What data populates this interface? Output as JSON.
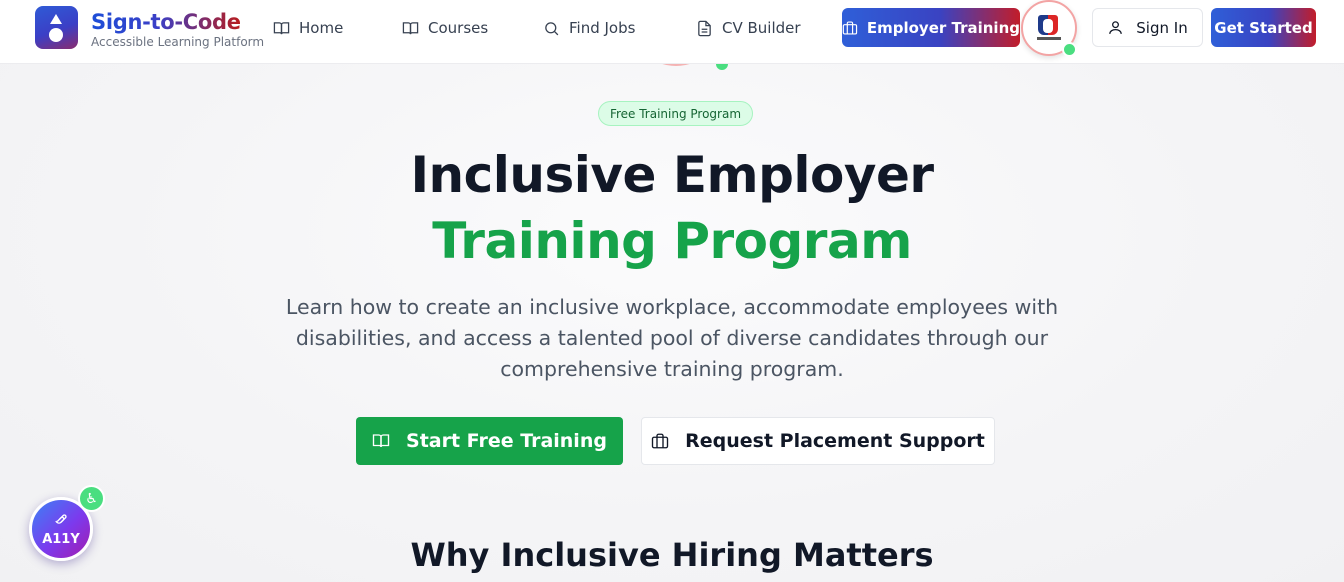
{
  "brand": {
    "name": "Sign-to-Code",
    "tagline": "Accessible Learning Platform",
    "logo_icon": "logo-icon"
  },
  "nav": {
    "items": [
      {
        "label": "Home",
        "icon": "book-open-icon"
      },
      {
        "label": "Courses",
        "icon": "book-open-icon"
      },
      {
        "label": "Find Jobs",
        "icon": "search-icon"
      },
      {
        "label": "CV Builder",
        "icon": "document-icon"
      }
    ],
    "employer_training": {
      "label": "Employer Training",
      "icon": "briefcase-icon"
    },
    "avatar": {
      "icon": "sign-language-avatar",
      "status": "online"
    },
    "sign_in": {
      "label": "Sign In",
      "icon": "user-icon"
    },
    "get_started": {
      "label": "Get Started"
    }
  },
  "hero": {
    "badge": "Free Training Program",
    "title_line1": "Inclusive Employer",
    "title_line2": "Training Program",
    "description": "Learn how to create an inclusive workplace, accommodate employees with disabilities, and access a talented pool of diverse candidates through our comprehensive training program.",
    "primary_button": {
      "label": "Start Free Training",
      "icon": "book-open-icon"
    },
    "secondary_button": {
      "label": "Request Placement Support",
      "icon": "briefcase-icon"
    }
  },
  "section": {
    "title": "Why Inclusive Hiring Matters"
  },
  "accessibility_widget": {
    "label": "A11Y",
    "icon": "hand-icon",
    "badge_icon": "accessibility-icon"
  },
  "colors": {
    "brand_blue": "#2f5fd8",
    "brand_red": "#c21d2a",
    "accent_green": "#16a34a",
    "badge_bg": "#dcfce7",
    "text_dark": "#111827",
    "text_muted": "#4b5563"
  }
}
